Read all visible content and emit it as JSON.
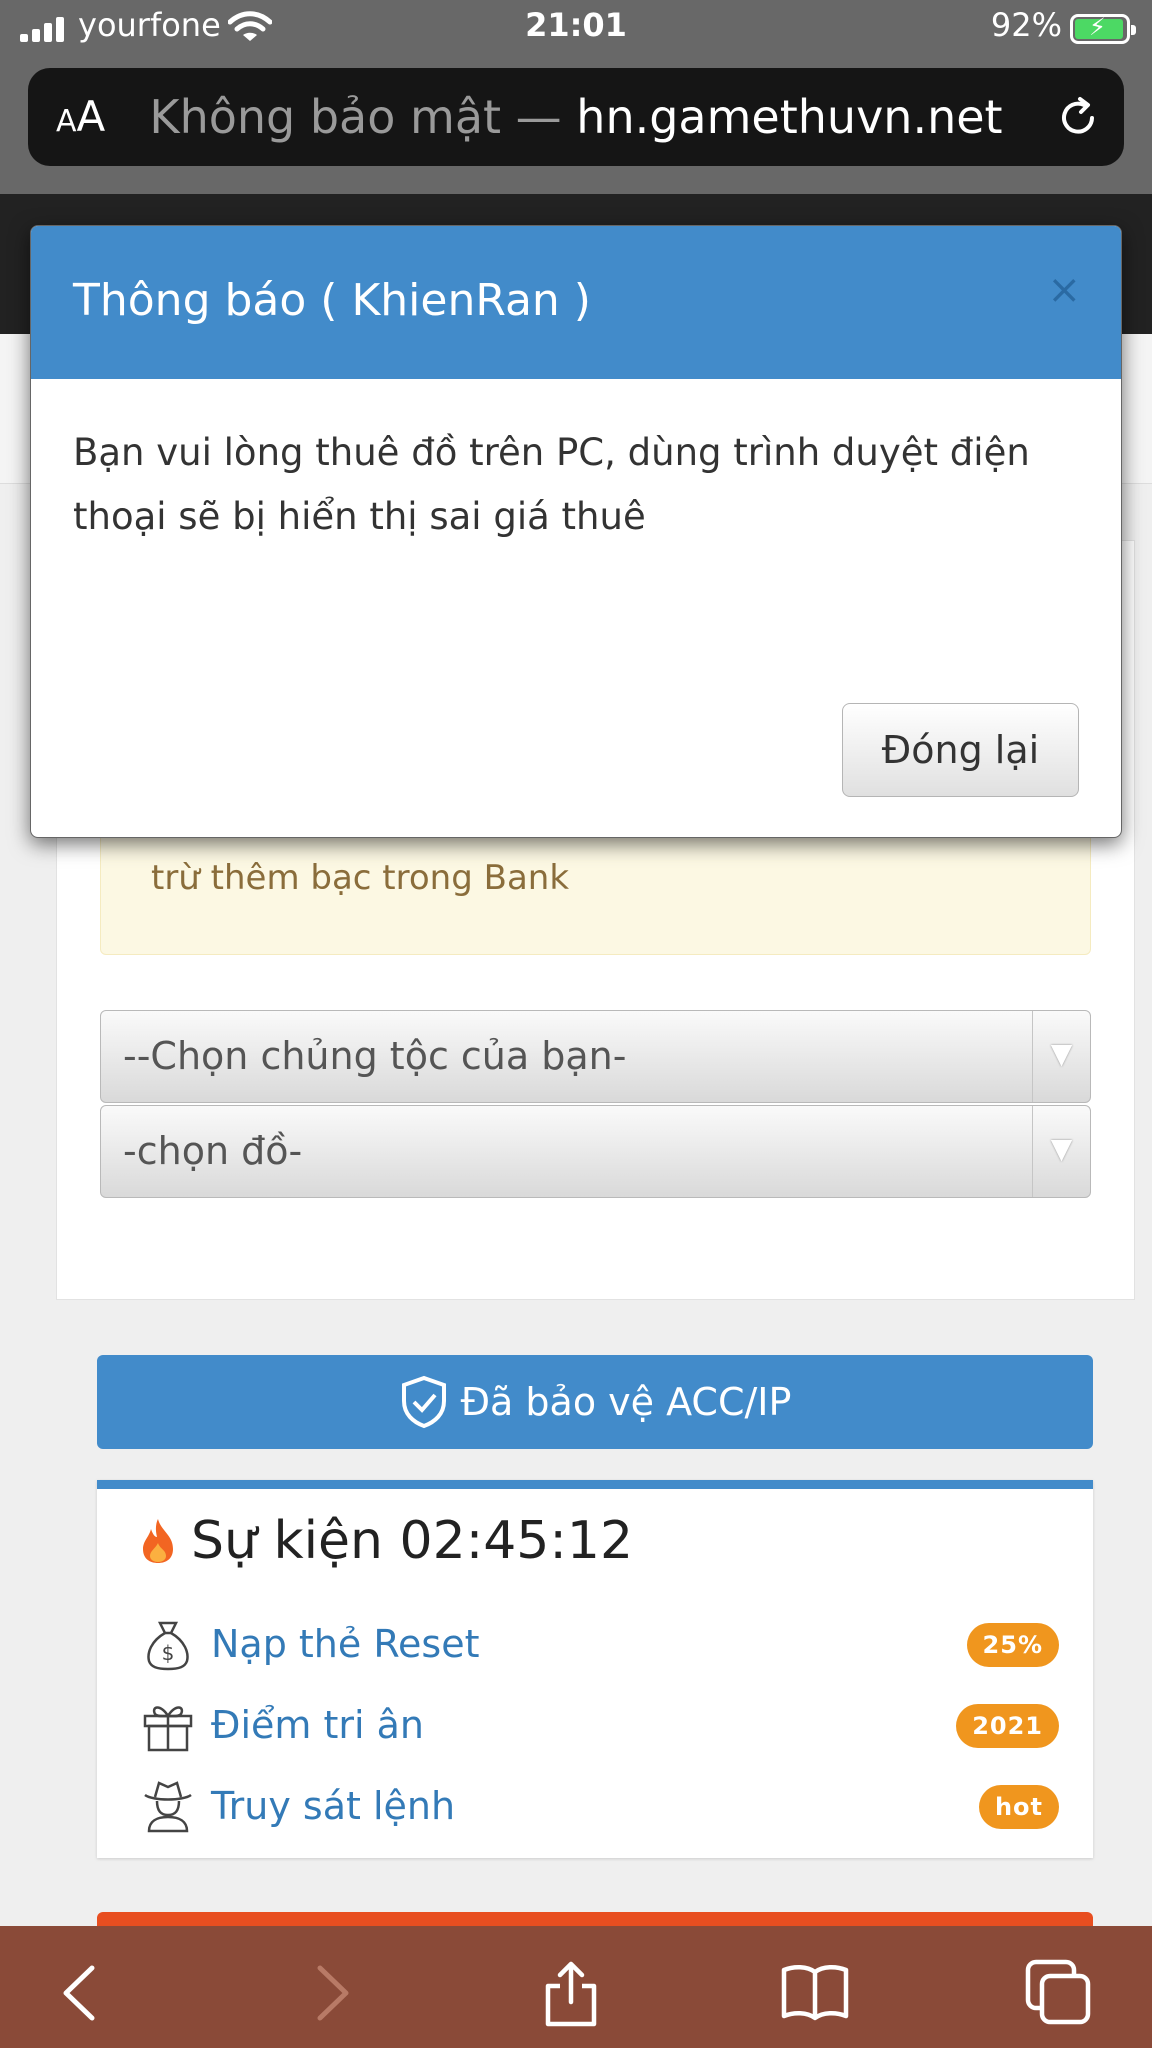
{
  "status_bar": {
    "carrier": "yourfone",
    "time": "21:01",
    "battery": "92%"
  },
  "url_bar": {
    "aa_small": "A",
    "aa_big": "A",
    "security_prefix": "Không bảo mật — ",
    "domain": "hn.gamethuvn.net"
  },
  "page": {
    "warning_text": "trừ thêm bạc trong Bank",
    "race_select": "--Chọn chủng tộc của bạn-",
    "item_select": "-chọn đồ-",
    "protect_button": "Đã bảo vệ ACC/IP",
    "event": {
      "title": "Sự kiện 02:45:12",
      "items": [
        {
          "label": "Nạp thẻ Reset",
          "badge": "25%",
          "icon": "money-bag-icon"
        },
        {
          "label": "Điểm tri ân",
          "badge": "2021",
          "icon": "gift-icon"
        },
        {
          "label": "Truy sát lệnh",
          "badge": "hot",
          "icon": "cowboy-icon"
        }
      ]
    }
  },
  "modal": {
    "title": "Thông báo ( KhienRan )",
    "close": "×",
    "body": "Bạn vui lòng thuê đồ trên PC, dùng trình duyệt điện thoại sẽ bị hiển thị sai giá thuê",
    "close_button": "Đóng lại"
  },
  "colors": {
    "primary": "#428bca",
    "badge": "#f0961e",
    "warning_bg": "#fcf8e3",
    "toolbar": "#8a4a38"
  }
}
